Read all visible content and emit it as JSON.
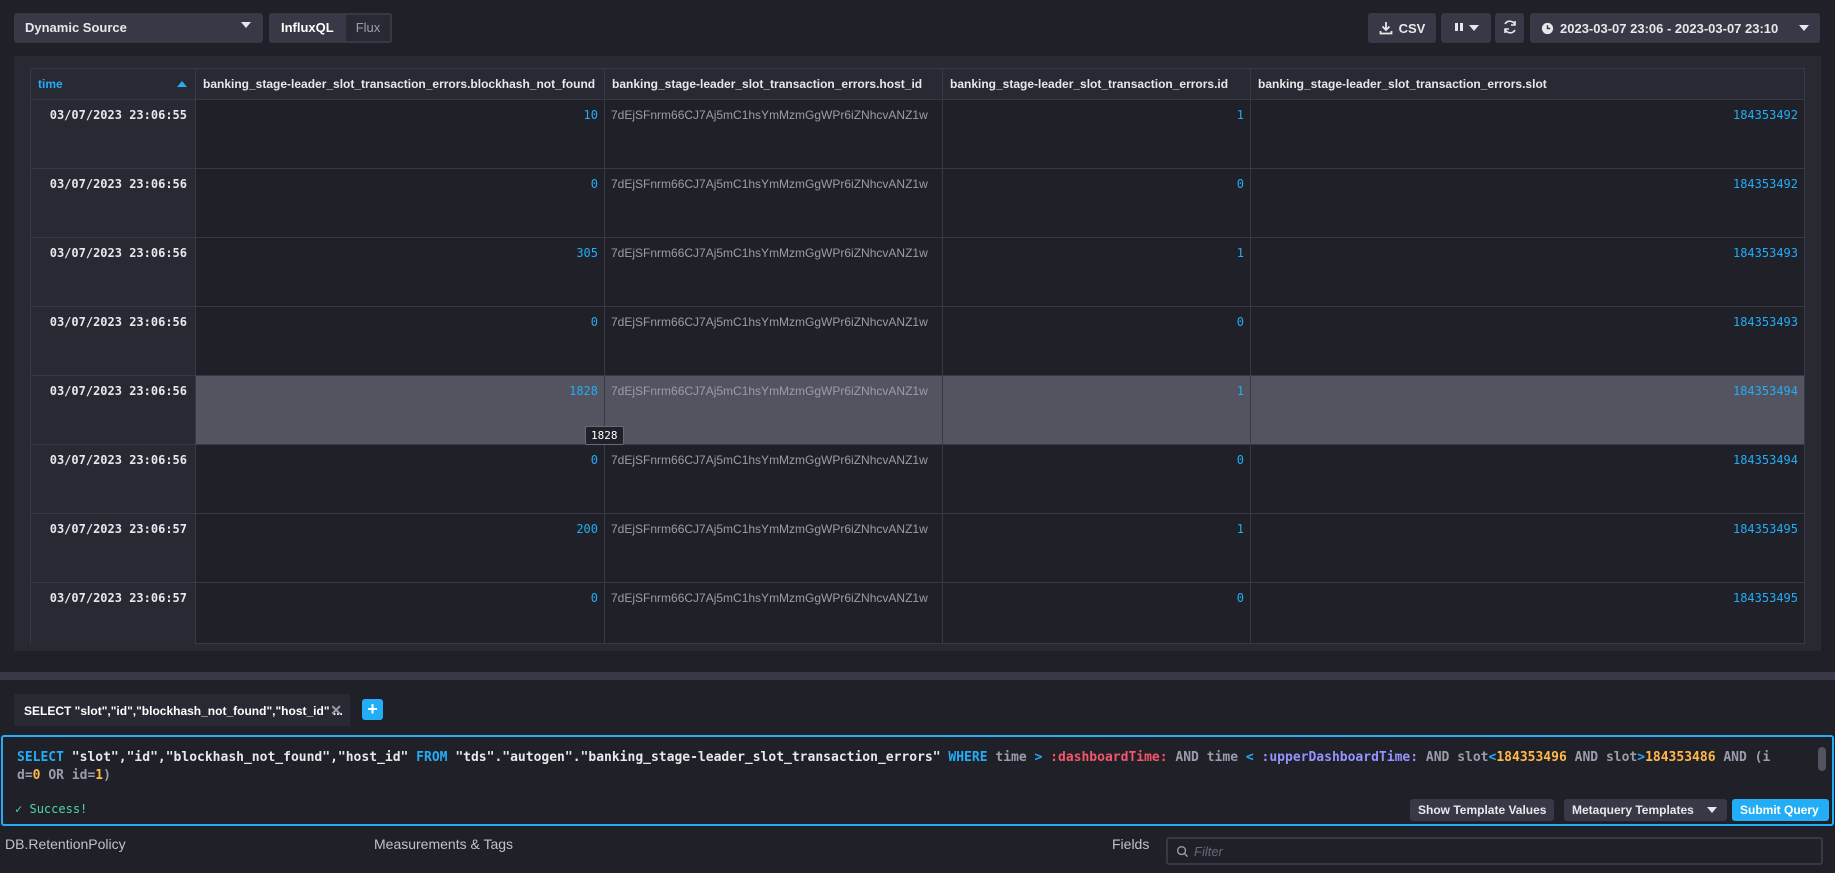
{
  "topbar": {
    "source": "Dynamic Source",
    "languages": [
      "InfluxQL",
      "Flux"
    ],
    "csv_label": "CSV",
    "time_range": "2023-03-07 23:06 - 2023-03-07 23:10"
  },
  "table": {
    "columns": [
      "time",
      "banking_stage-leader_slot_transaction_errors.blockhash_not_found",
      "banking_stage-leader_slot_transaction_errors.host_id",
      "banking_stage-leader_slot_transaction_errors.id",
      "banking_stage-leader_slot_transaction_errors.slot"
    ],
    "rows": [
      {
        "time": "03/07/2023 23:06:55",
        "blockhash_not_found": "10",
        "host_id": "7dEjSFnrm66CJ7Aj5mC1hsYmMzmGgWPr6iZNhcvANZ1w",
        "id": "1",
        "slot": "184353492"
      },
      {
        "time": "03/07/2023 23:06:56",
        "blockhash_not_found": "0",
        "host_id": "7dEjSFnrm66CJ7Aj5mC1hsYmMzmGgWPr6iZNhcvANZ1w",
        "id": "0",
        "slot": "184353492"
      },
      {
        "time": "03/07/2023 23:06:56",
        "blockhash_not_found": "305",
        "host_id": "7dEjSFnrm66CJ7Aj5mC1hsYmMzmGgWPr6iZNhcvANZ1w",
        "id": "1",
        "slot": "184353493"
      },
      {
        "time": "03/07/2023 23:06:56",
        "blockhash_not_found": "0",
        "host_id": "7dEjSFnrm66CJ7Aj5mC1hsYmMzmGgWPr6iZNhcvANZ1w",
        "id": "0",
        "slot": "184353493"
      },
      {
        "time": "03/07/2023 23:06:56",
        "blockhash_not_found": "1828",
        "host_id": "7dEjSFnrm66CJ7Aj5mC1hsYmMzmGgWPr6iZNhcvANZ1w",
        "id": "1",
        "slot": "184353494"
      },
      {
        "time": "03/07/2023 23:06:56",
        "blockhash_not_found": "0",
        "host_id": "7dEjSFnrm66CJ7Aj5mC1hsYmMzmGgWPr6iZNhcvANZ1w",
        "id": "0",
        "slot": "184353494"
      },
      {
        "time": "03/07/2023 23:06:57",
        "blockhash_not_found": "200",
        "host_id": "7dEjSFnrm66CJ7Aj5mC1hsYmMzmGgWPr6iZNhcvANZ1w",
        "id": "1",
        "slot": "184353495"
      },
      {
        "time": "03/07/2023 23:06:57",
        "blockhash_not_found": "0",
        "host_id": "7dEjSFnrm66CJ7Aj5mC1hsYmMzmGgWPr6iZNhcvANZ1w",
        "id": "0",
        "slot": "184353495"
      }
    ],
    "tooltip": "1828"
  },
  "query": {
    "tab_label": "SELECT \"slot\",\"id\",\"blockhash_not_found\",\"host_id\" ...",
    "tokens": {
      "select": "SELECT",
      "fields": "\"slot\",\"id\",\"blockhash_not_found\",\"host_id\"",
      "from": "FROM",
      "measurement": "\"tds\".\"autogen\".\"banking_stage-leader_slot_transaction_errors\"",
      "where": "WHERE",
      "time1": "time",
      "gt": ">",
      "dash_time": ":dashboardTime:",
      "and1": "AND",
      "time2": "time",
      "lt": "<",
      "upper_time": ":upperDashboardTime:",
      "and2": "AND",
      "slot1": "slot",
      "lt2": "<",
      "slot_hi": "184353496",
      "and3": "AND",
      "slot2": "slot",
      "gt2": ">",
      "slot_lo": "184353486",
      "and4": "AND",
      "open_id": "(id",
      "eq1": "=",
      "id0": "0",
      "or": "OR",
      "id_kw": "id",
      "eq2": "=",
      "id1": "1",
      "close": ")"
    },
    "status": "Success!",
    "show_template_values": "Show Template Values",
    "metaquery_templates": "Metaquery Templates",
    "submit": "Submit Query"
  },
  "schema": {
    "db_header": "DB.RetentionPolicy",
    "measurements_header": "Measurements & Tags",
    "fields_header": "Fields",
    "filter_placeholder": "Filter"
  },
  "colors": {
    "accent": "#22adf6",
    "success": "#4ed8a0",
    "template_var_pink": "#f2566a",
    "template_var_purple": "#9394ff",
    "number": "#ffb94a"
  }
}
